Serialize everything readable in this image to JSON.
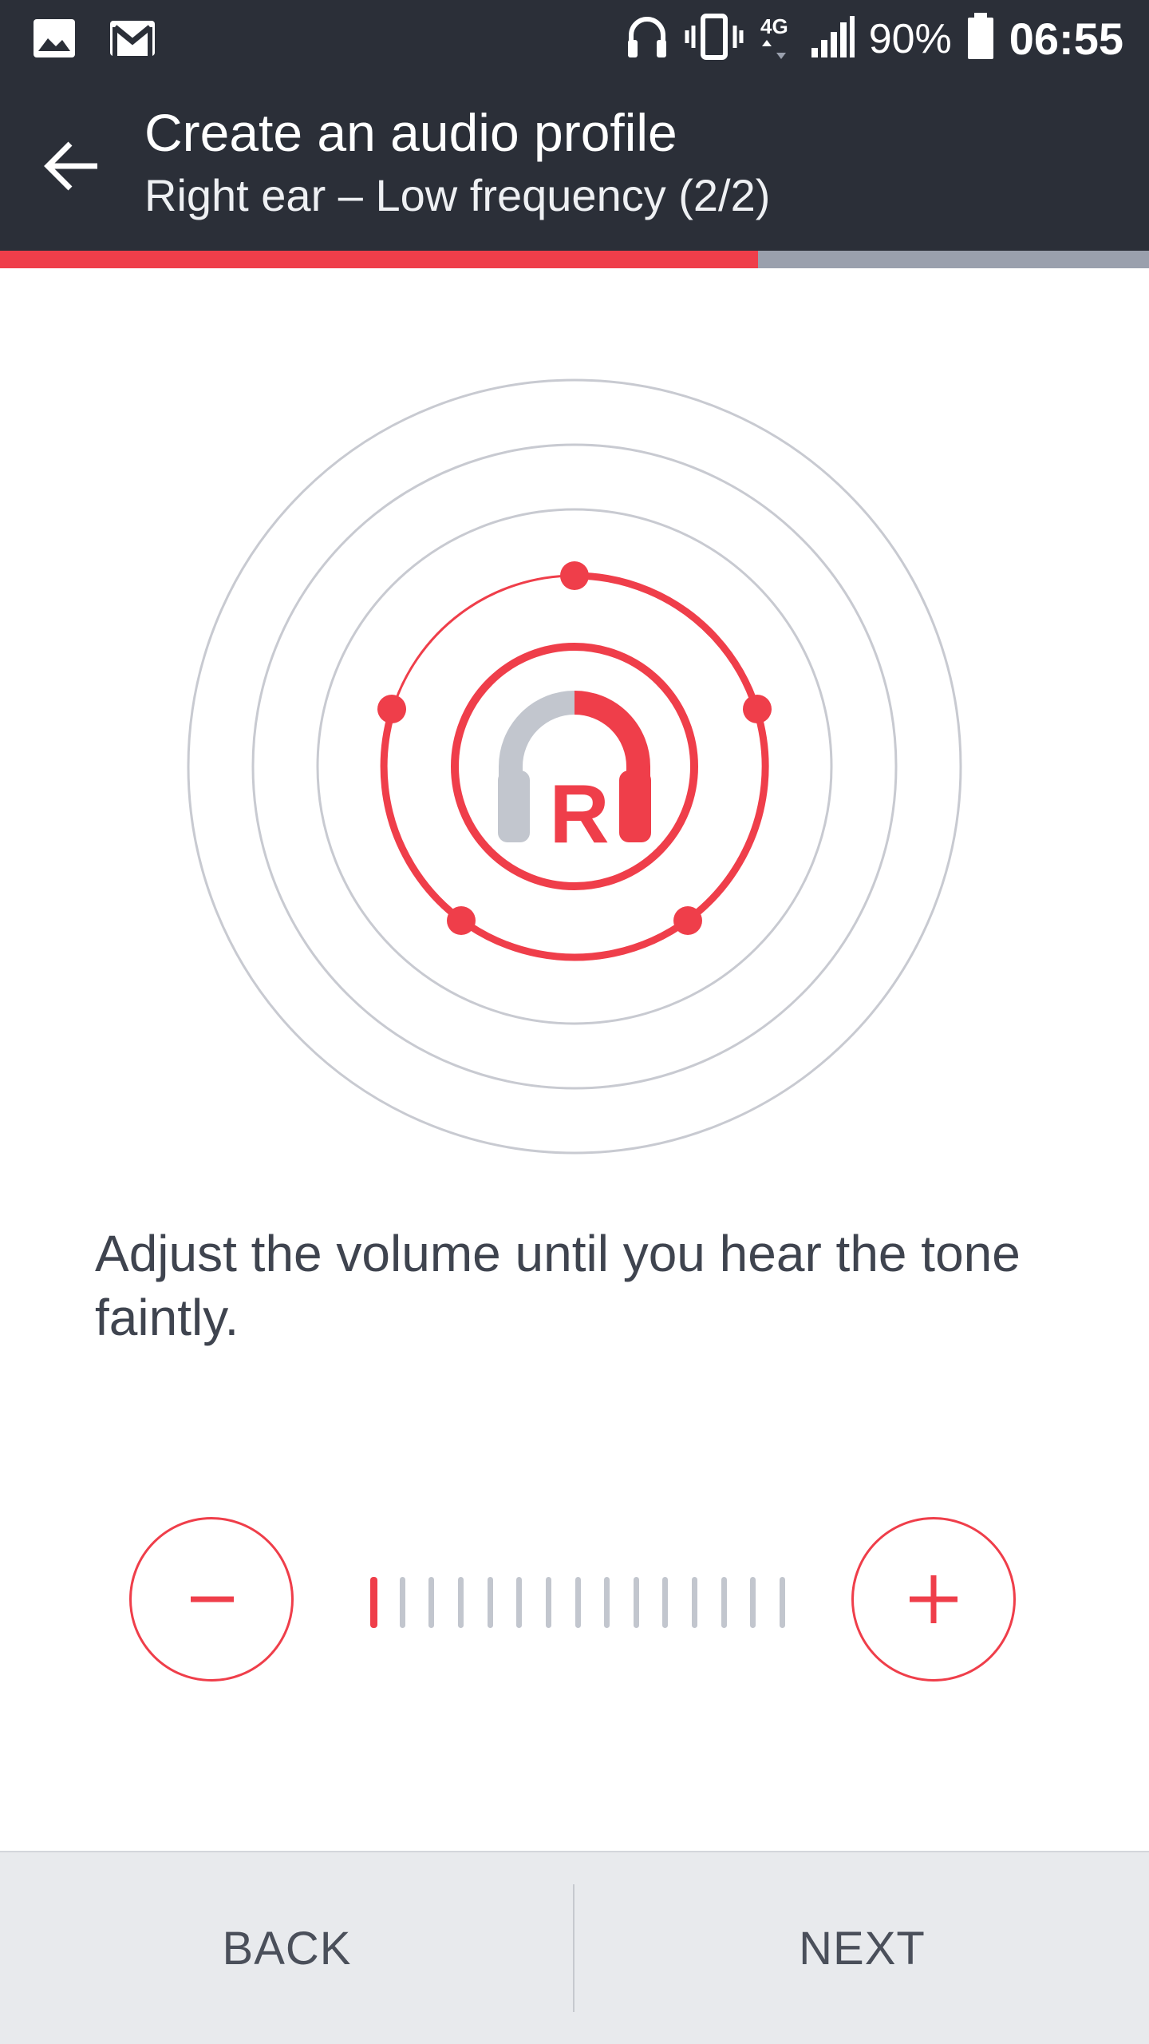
{
  "status_bar": {
    "left_icons": [
      "image-icon",
      "gmail-icon"
    ],
    "right_icons": [
      "headset-icon",
      "vibrate-icon",
      "network-4g-icon",
      "signal-icon"
    ],
    "battery_percent": "90%",
    "battery_icon": "battery-icon",
    "time": "06:55"
  },
  "app_bar": {
    "back_icon": "arrow-left-icon",
    "title": "Create an audio profile",
    "subtitle": "Right ear – Low frequency (2/2)"
  },
  "progress": {
    "value": 0.66,
    "fill_color": "#ef3e4a",
    "track_color": "#9aa0ad"
  },
  "visual": {
    "ear_label": "R",
    "icon": "headphones-icon",
    "accent_color": "#ef3e4a",
    "ring_color": "#c8cad1"
  },
  "instruction": "Adjust the volume until you hear the tone faintly.",
  "volume": {
    "decrease_icon": "minus-icon",
    "increase_icon": "plus-icon",
    "level": 1,
    "steps": 15
  },
  "bottom_bar": {
    "back_label": "BACK",
    "next_label": "NEXT"
  }
}
